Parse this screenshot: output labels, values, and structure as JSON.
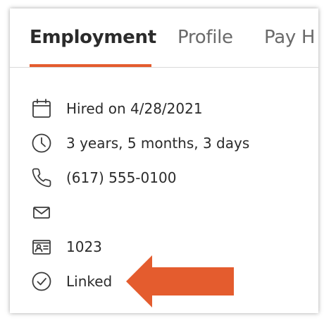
{
  "tabs": [
    {
      "label": "Employment",
      "active": true
    },
    {
      "label": "Profile",
      "active": false
    },
    {
      "label": "Pay H",
      "active": false
    }
  ],
  "details": {
    "hired": {
      "icon": "calendar-icon",
      "text": "Hired on 4/28/2021"
    },
    "tenure": {
      "icon": "clock-icon",
      "text": "3 years, 5 months, 3 days"
    },
    "phone": {
      "icon": "phone-icon",
      "text": "(617) 555-0100"
    },
    "email": {
      "icon": "envelope-icon",
      "text": ""
    },
    "employee_id": {
      "icon": "id-card-icon",
      "text": "1023"
    },
    "status": {
      "icon": "check-circle-icon",
      "text": "Linked"
    }
  },
  "annotation": {
    "icon": "arrow-left-icon"
  },
  "colors": {
    "accent": "#e45c2e",
    "text": "#2b2b2b",
    "muted_text": "#6a6a6a",
    "icon": "#3c3c3c"
  }
}
